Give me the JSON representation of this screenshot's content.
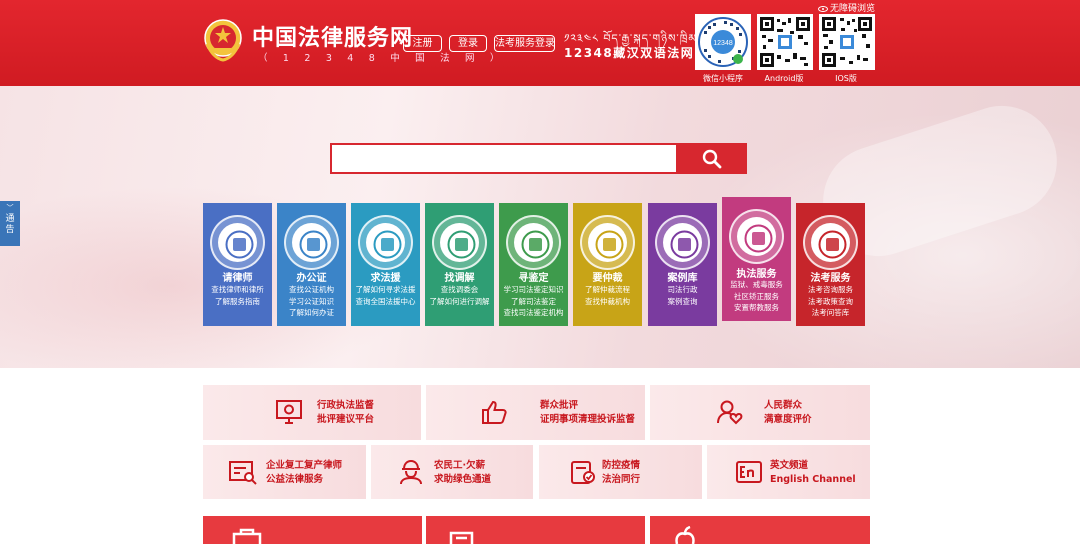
{
  "header": {
    "title": "中国法律服务网",
    "subtitle": "（ 1 2 3 4 8 中 国 法 网 ）",
    "register_label": "注册",
    "login_label": "登录",
    "exam_login_label": "法考服务登录",
    "tibetan_text": "༡༢༣༤༨ བོད་རྒྱ་སྐད་གཉིས་ཁྲིམས་དྲ།",
    "bilingual_text": "12348藏汉双语法网",
    "accessibility_label": "无障碍浏览",
    "qr_codes": [
      {
        "label": "微信小程序"
      },
      {
        "label": "Android版"
      },
      {
        "label": "IOS版"
      }
    ],
    "brand_color": "#d7272f"
  },
  "side_notice": {
    "label": "通告"
  },
  "search": {
    "placeholder": ""
  },
  "tiles": [
    {
      "name": "请律师",
      "desc": [
        "查找律师和律所",
        "了解服务指南"
      ],
      "color": "#4a6fc4"
    },
    {
      "name": "办公证",
      "desc": [
        "查找公证机构",
        "学习公证知识",
        "了解如何办证"
      ],
      "color": "#3b84c8"
    },
    {
      "name": "求法援",
      "desc": [
        "了解如何寻求法援",
        "查询全国法援中心"
      ],
      "color": "#2b9bc1"
    },
    {
      "name": "找调解",
      "desc": [
        "查找调委会",
        "了解如何进行调解"
      ],
      "color": "#2f9e74"
    },
    {
      "name": "寻鉴定",
      "desc": [
        "学习司法鉴定知识",
        "了解司法鉴定",
        "查找司法鉴定机构"
      ],
      "color": "#3e9b4c"
    },
    {
      "name": "要仲裁",
      "desc": [
        "了解仲裁流程",
        "查找仲裁机构"
      ],
      "color": "#c8a417"
    },
    {
      "name": "案例库",
      "desc": [
        "司法行政",
        "案例查询"
      ],
      "color": "#7a3b9f"
    },
    {
      "name": "执法服务",
      "desc": [
        "监狱、戒毒服务",
        "社区矫正服务",
        "安置帮教服务"
      ],
      "color": "#c23b7f"
    },
    {
      "name": "法考服务",
      "desc": [
        "法考咨询服务",
        "法考政策查询",
        "法考问答库"
      ],
      "color": "#c6252b"
    }
  ],
  "services_row1": [
    {
      "lines": [
        "行政执法监督",
        "批评建议平台"
      ],
      "icon": "monitor-icon"
    },
    {
      "lines": [
        "群众批评",
        "证明事项清理投诉监督"
      ],
      "icon": "thumbs-up-icon"
    },
    {
      "lines": [
        "人民群众",
        "满意度评价"
      ],
      "icon": "user-heart-icon"
    }
  ],
  "services_row2": [
    {
      "lines": [
        "企业复工复产律师",
        "公益法律服务"
      ],
      "icon": "document-search-icon"
    },
    {
      "lines": [
        "农民工·欠薪",
        "求助绿色通道"
      ],
      "icon": "worker-icon"
    },
    {
      "lines": [
        "防控疫情",
        "法治同行"
      ],
      "icon": "shield-check-icon"
    },
    {
      "lines": [
        "英文频道",
        "English Channel"
      ],
      "icon": "english-icon"
    }
  ]
}
